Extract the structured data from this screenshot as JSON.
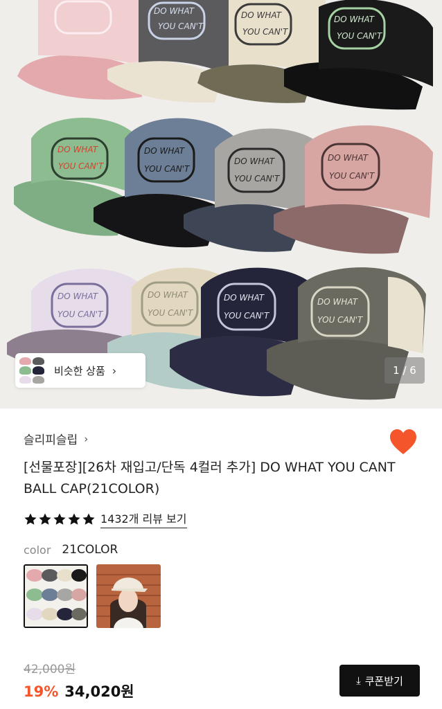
{
  "gallery": {
    "similar_label": "비슷한 상품",
    "page_indicator": "1 / 6",
    "cap_logo_line1": "DO WHAT",
    "cap_logo_line2": "YOU CAN'T"
  },
  "product": {
    "brand": "슬리피슬립",
    "brand_arrow": "›",
    "title": "[선물포장][26차 재입고/단독 4컬러 추가] DO WHAT YOU CANT BALL CAP(21COLOR)",
    "rating_stars": 5,
    "review_link": "1432개 리뷰 보기",
    "color_label": "color",
    "color_value": "21COLOR",
    "original_price": "42,000원",
    "discount": "19%",
    "price": "34,020원",
    "coupon_label": "쿠폰받기"
  },
  "colors": {
    "heart": "#f4552b",
    "discount": "#f4552b",
    "button_bg": "#111111"
  },
  "icons": {
    "wishlist": "heart-icon",
    "star": "star-icon",
    "coupon": "download-icon",
    "chevron": "chevron-right-icon"
  }
}
